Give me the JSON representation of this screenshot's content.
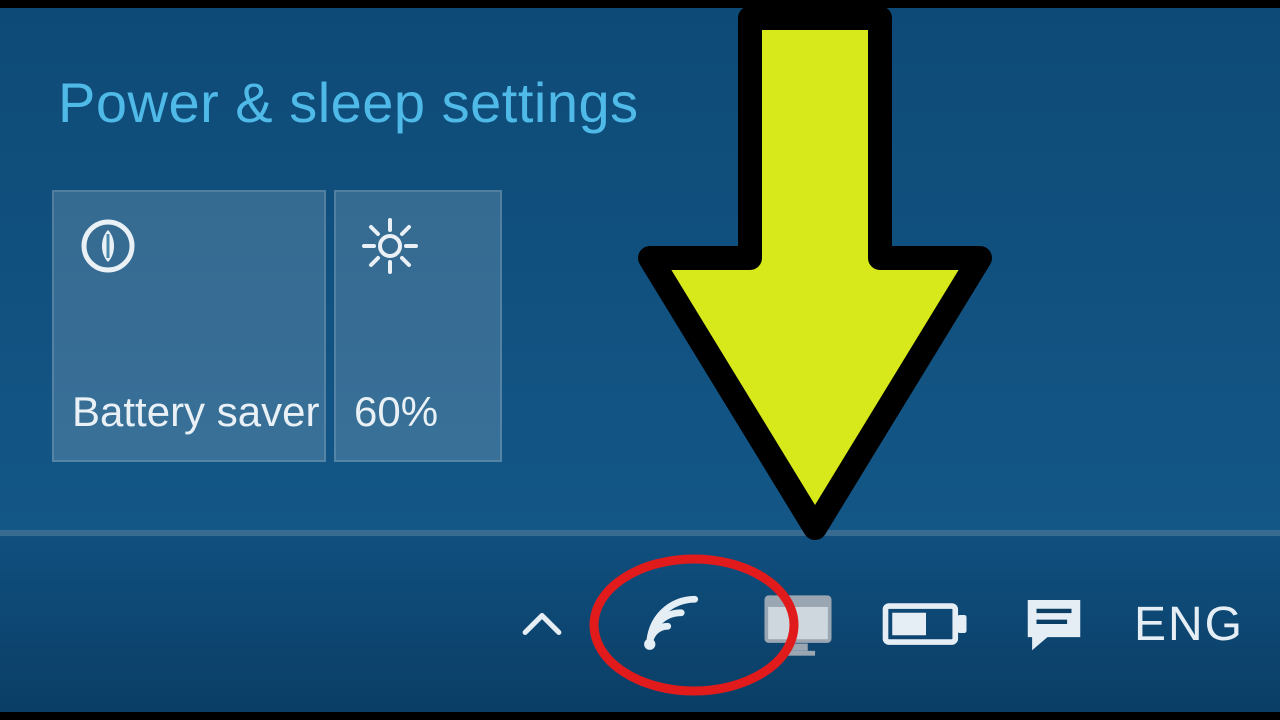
{
  "actionCenter": {
    "settings_link": "Power & sleep settings",
    "tiles": {
      "battery_saver": {
        "label": "Battery saver",
        "icon": "leaf-circle-icon"
      },
      "brightness": {
        "label": "60%",
        "icon": "brightness-icon"
      }
    }
  },
  "taskbar": {
    "language": "ENG",
    "tray_icons": {
      "overflow": "chevron-up-icon",
      "wifi": "wifi-icon",
      "display": "monitor-icon",
      "battery": "battery-icon",
      "action_center": "action-center-icon"
    }
  },
  "annotations": {
    "arrow_color": "#d7e91a",
    "arrow_outline": "#000000",
    "circle_color": "#e11b1b"
  }
}
